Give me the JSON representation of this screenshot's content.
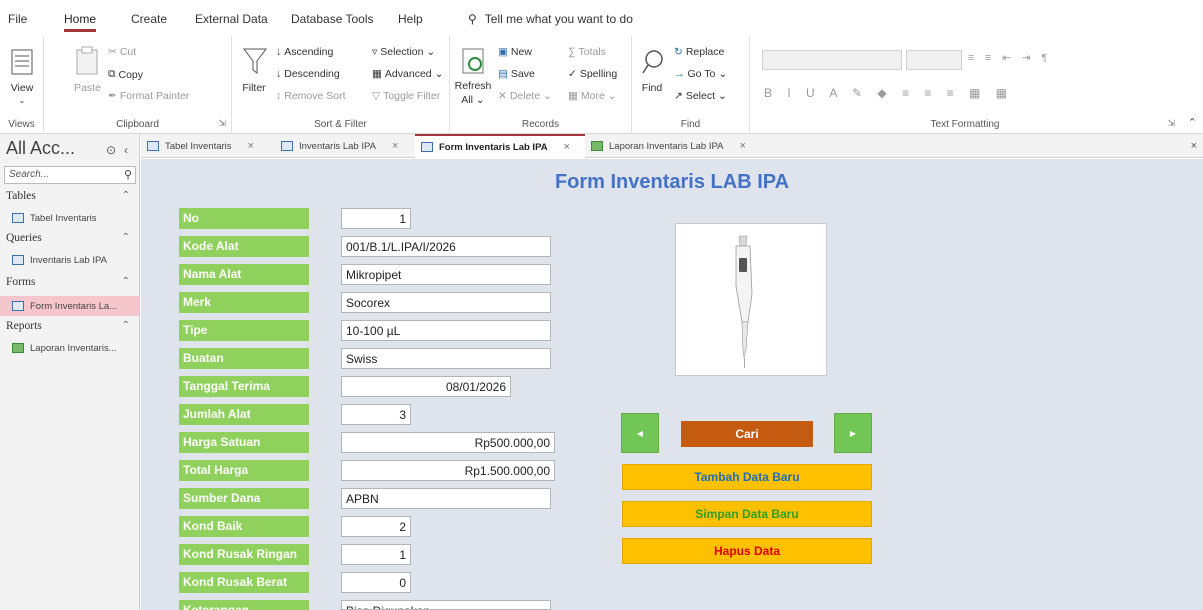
{
  "menu": {
    "file": "File",
    "home": "Home",
    "create": "Create",
    "external_data": "External Data",
    "database_tools": "Database Tools",
    "help": "Help",
    "tell_me": "Tell me what you want to do"
  },
  "ribbon": {
    "views": {
      "view": "View",
      "label": "Views"
    },
    "clipboard": {
      "paste": "Paste",
      "cut": "Cut",
      "copy": "Copy",
      "format_painter": "Format Painter",
      "label": "Clipboard"
    },
    "sort_filter": {
      "filter": "Filter",
      "ascending": "Ascending",
      "descending": "Descending",
      "remove_sort": "Remove Sort",
      "selection": "Selection",
      "advanced": "Advanced",
      "toggle_filter": "Toggle Filter",
      "label": "Sort & Filter"
    },
    "records": {
      "refresh": "Refresh",
      "refresh_all": "All",
      "new": "New",
      "save": "Save",
      "delete": "Delete",
      "totals": "Totals",
      "spelling": "Spelling",
      "more": "More",
      "label": "Records"
    },
    "find": {
      "find": "Find",
      "replace": "Replace",
      "goto": "Go To",
      "select": "Select",
      "label": "Find"
    },
    "text_formatting": {
      "label": "Text Formatting"
    }
  },
  "nav": {
    "title": "All Acc...",
    "search_placeholder": "Search...",
    "sections": [
      {
        "name": "Tables",
        "items": [
          "Tabel Inventaris"
        ]
      },
      {
        "name": "Queries",
        "items": [
          "Inventaris Lab IPA"
        ]
      },
      {
        "name": "Forms",
        "items": [
          "Form Inventaris La..."
        ]
      },
      {
        "name": "Reports",
        "items": [
          "Laporan Inventaris..."
        ]
      }
    ]
  },
  "tabs": [
    {
      "label": "Tabel Inventaris"
    },
    {
      "label": "Inventaris Lab IPA"
    },
    {
      "label": "Form Inventaris Lab IPA"
    },
    {
      "label": "Laporan Inventaris Lab IPA"
    }
  ],
  "form": {
    "title": "Form Inventaris LAB IPA",
    "fields": [
      {
        "label": "No",
        "value": "1"
      },
      {
        "label": "Kode Alat",
        "value": "001/B.1/L.IPA/I/2026"
      },
      {
        "label": "Nama Alat",
        "value": "Mikropipet"
      },
      {
        "label": "Merk",
        "value": "Socorex"
      },
      {
        "label": "Tipe",
        "value": "10-100 µL"
      },
      {
        "label": "Buatan",
        "value": "Swiss"
      },
      {
        "label": "Tanggal Terima",
        "value": "08/01/2026"
      },
      {
        "label": "Jumlah Alat",
        "value": "3"
      },
      {
        "label": "Harga Satuan",
        "value": "Rp500.000,00"
      },
      {
        "label": "Total Harga",
        "value": "Rp1.500.000,00"
      },
      {
        "label": "Sumber Dana",
        "value": "APBN"
      },
      {
        "label": "Kond Baik",
        "value": "2"
      },
      {
        "label": "Kond Rusak Ringan",
        "value": "1"
      },
      {
        "label": "Kond Rusak Berat",
        "value": "0"
      },
      {
        "label": "Keterangan",
        "value": "Bisa Digunakan"
      }
    ],
    "buttons": {
      "cari": "Cari",
      "tambah": "Tambah Data Baru",
      "simpan": "Simpan Data Baru",
      "hapus": "Hapus Data"
    }
  },
  "colors": {
    "accent": "#a4373a",
    "label_bg": "#8fd15c",
    "form_bg": "#dee3ec",
    "title_blue": "#4472c4",
    "cari_bg": "#c55a11",
    "action_bg": "#ffc000",
    "tambah_text": "#1f6fb5",
    "simpan_text": "#2e9e2e",
    "hapus_text": "#e00000"
  }
}
